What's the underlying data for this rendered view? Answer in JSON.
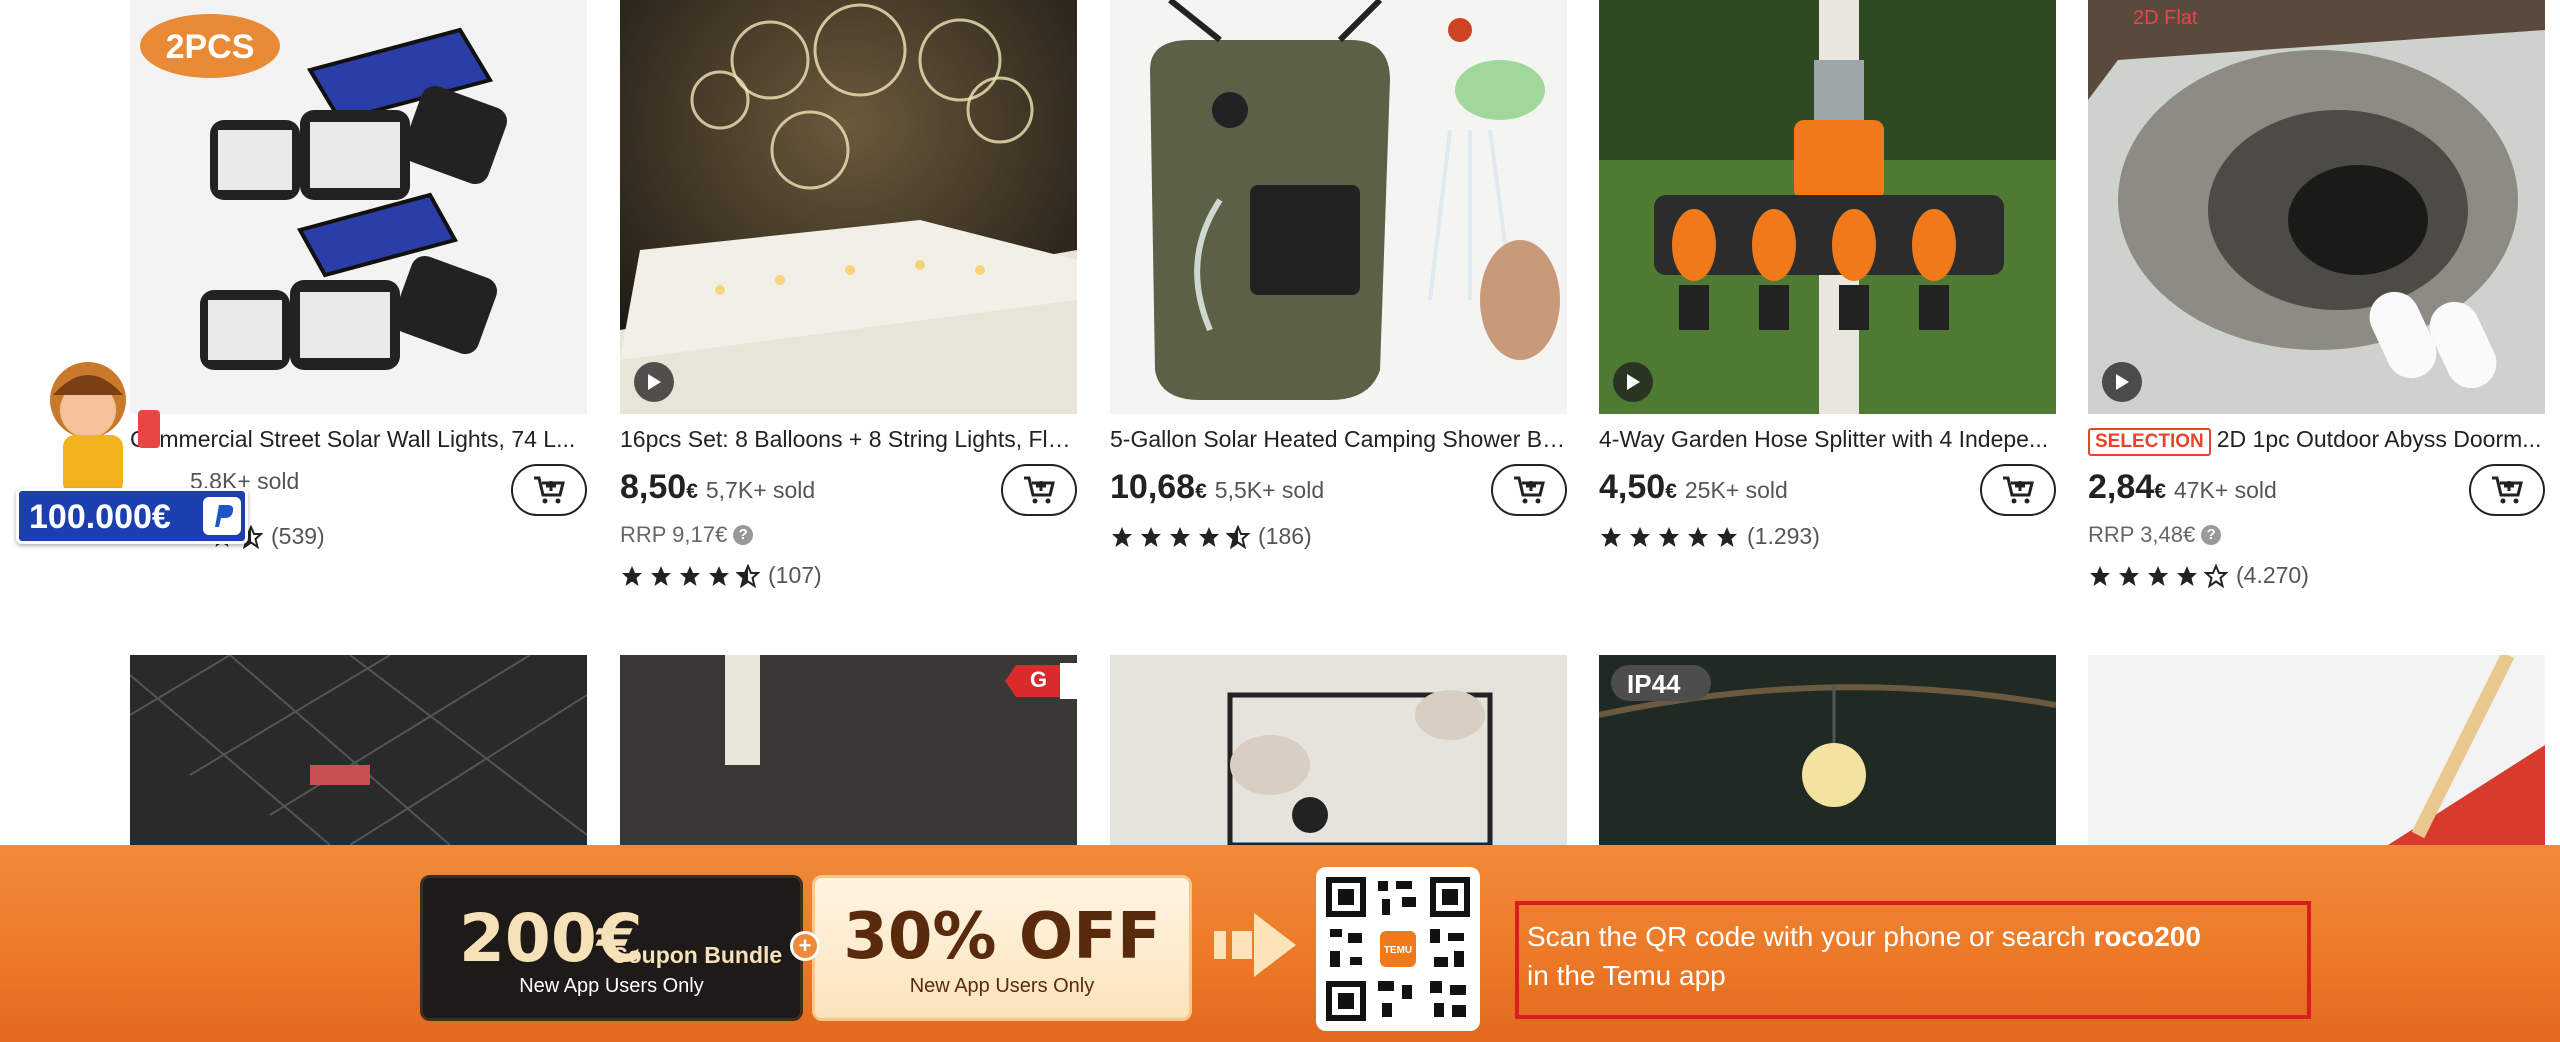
{
  "products": [
    {
      "title": "Commercial Street Solar Wall Lights, 74 L...",
      "price_main": "",
      "price_cur": "",
      "sold": "5,8K+ sold",
      "rrp": "",
      "rating_count": "(539)",
      "stars": 4.5,
      "image_tag": "2PCS"
    },
    {
      "title": "16pcs Set: 8 Balloons + 8 String Lights, Flo...",
      "price_main": "8,50",
      "price_cur": "€",
      "sold": "5,7K+ sold",
      "rrp": "RRP 9,17€",
      "rating_count": "(107)",
      "stars": 4.5
    },
    {
      "title": "5-Gallon Solar Heated Camping Shower Ba...",
      "price_main": "10,68",
      "price_cur": "€",
      "sold": "5,5K+ sold",
      "rrp": "",
      "rating_count": "(186)",
      "stars": 4.5
    },
    {
      "title": "4-Way Garden Hose Splitter with 4 Indepe...",
      "price_main": "4,50",
      "price_cur": "€",
      "sold": "25K+ sold",
      "rrp": "",
      "rating_count": "(1.293)",
      "stars": 5
    },
    {
      "title": "2D 1pc Outdoor Abyss Doorm...",
      "tag": "SELECTION",
      "image_tag": "2D Flat",
      "price_main": "2,84",
      "price_cur": "€",
      "sold": "47K+ sold",
      "rrp": "RRP 3,48€",
      "rating_count": "(4.270)",
      "stars": 4
    }
  ],
  "tiles": [
    {
      "tag": ""
    },
    {
      "tag": "G"
    },
    {
      "tag": ""
    },
    {
      "tag": "IP44"
    },
    {
      "tag": ""
    }
  ],
  "float_badge": {
    "amount": "100.000€"
  },
  "banner": {
    "bundle_amount": "200€",
    "bundle_label": "Coupon Bundle",
    "bundle_sub": "New App Users Only",
    "plus": "+",
    "off_big": "30% OFF",
    "off_sub": "New App Users Only",
    "scan_line1_a": "Scan the QR code with your phone or search ",
    "scan_code": "roco200",
    "scan_line2": "in the Temu app",
    "qr_center_label": "TEMU"
  },
  "colors": {
    "banner": "#ec7a28",
    "scan_border": "#d81e1e",
    "selection": "#e8442c",
    "badge_blue": "#1c3fb0"
  },
  "icons": [
    "cart-icon",
    "play-icon",
    "star-icon",
    "arrow-right-icon",
    "qr-code",
    "help-icon"
  ]
}
